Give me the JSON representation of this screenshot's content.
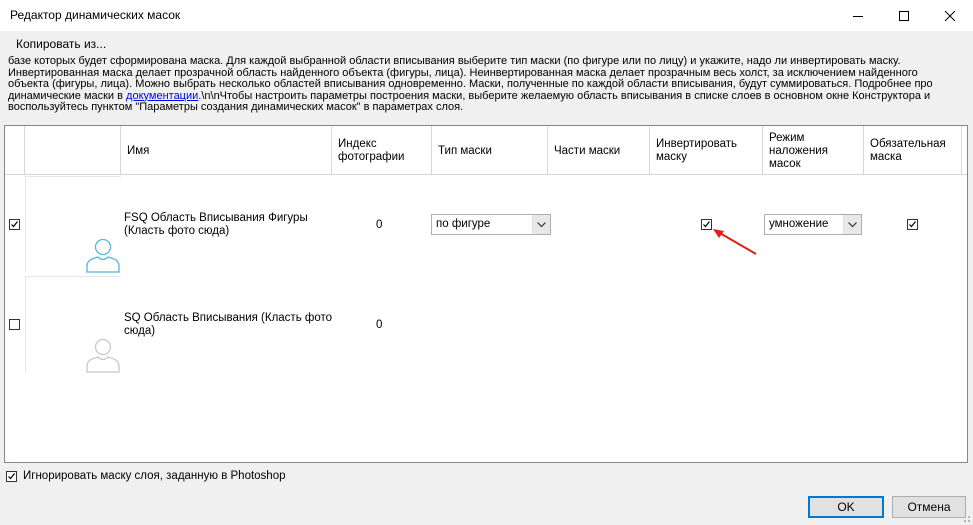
{
  "window": {
    "title": "Редактор динамических масок",
    "minimize_icon": "minimize-icon",
    "maximize_icon": "maximize-icon",
    "close_icon": "close-icon"
  },
  "menu": {
    "copy_from": "Копировать из..."
  },
  "info": {
    "line1": "базе которых будет сформирована маска. Для каждой выбранной области вписывания выберите тип маски (по фигуре или по лицу) и укажите, надо ли инвертировать маску.",
    "line2": "Инвертированная маска делает прозрачной область найденного объекта (фигуры, лица). Неинвертированная маска делает прозрачным весь холст, за исключением найденного",
    "line3": "объекта (фигуры, лица). Можно выбрать несколько областей вписывания одновременно. Маски, полученные по каждой области вписывания, будут суммироваться. Подробнее про",
    "line4_prefix": "динамические маски в ",
    "line4_link": "документации",
    "line4_suffix": ".\\n\\nЧтобы настроить параметры построения маски, выберите желаемую область вписывания в списке слоев в основном окне Конструктора и",
    "line5": "воспользуйтесь пунктом \"Параметры создания динамических масок\" в параметрах слоя."
  },
  "table": {
    "columns": {
      "name": "Имя",
      "photo_index": [
        "Индекс",
        "фотографии"
      ],
      "mask_type": "Тип маски",
      "mask_parts": "Части маски",
      "invert": [
        "Инвертировать",
        "маску"
      ],
      "blend_mode": [
        "Режим",
        "наложения",
        "масок"
      ],
      "required": [
        "Обязательная",
        "маска"
      ]
    },
    "rows": [
      {
        "selected": true,
        "name_line1": "FSQ Область Вписывания Фигуры",
        "name_line2": "(Класть фото сюда)",
        "photo_index": "0",
        "mask_type": "по фигуре",
        "invert": true,
        "blend_mode": "умножение",
        "required": true,
        "thumb_icon": "person-silhouette-icon",
        "thumb_color": "#4fb7d8"
      },
      {
        "selected": false,
        "name_line1": "SQ Область Вписывания (Класть фото",
        "name_line2": "сюда)",
        "photo_index": "0",
        "thumb_icon": "person-silhouette-icon",
        "thumb_color": "#c8c8c8"
      }
    ]
  },
  "annotation": {
    "icon": "red-arrow-icon",
    "color": "#e0201c"
  },
  "footer": {
    "ignore_checked": true,
    "ignore_label": "Игнорировать маску слоя, заданную в Photoshop",
    "ok": "OK",
    "cancel": "Отмена"
  },
  "colors": {
    "accent": "#0078d7",
    "link": "#0000ee"
  }
}
